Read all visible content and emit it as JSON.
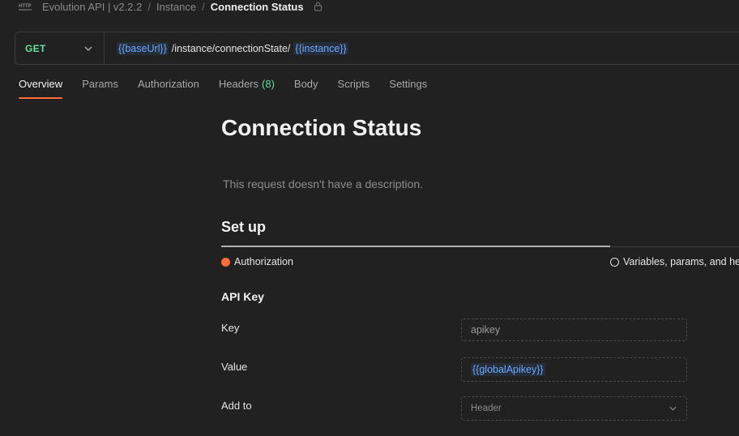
{
  "breadcrumb": {
    "icon": "http-icon",
    "collection": "Evolution API | v2.2.2",
    "folder": "Instance",
    "separator": "/",
    "current": "Connection Status",
    "lock_icon": "lock-icon"
  },
  "request": {
    "method": "GET",
    "url_parts": {
      "base": "{{baseUrl}}",
      "path": "/instance/connectionState/",
      "instance": "{{instance}}"
    }
  },
  "tabs": [
    {
      "label": "Overview",
      "active": true
    },
    {
      "label": "Params"
    },
    {
      "label": "Authorization"
    },
    {
      "label": "Headers",
      "count": "(8)"
    },
    {
      "label": "Body"
    },
    {
      "label": "Scripts"
    },
    {
      "label": "Settings"
    }
  ],
  "overview": {
    "title": "Connection Status",
    "description": "This request doesn't have a description.",
    "setup": {
      "heading": "Set up",
      "steps": [
        "Authorization",
        "Variables, params, and he"
      ]
    },
    "api_key": {
      "heading": "API Key",
      "key_label": "Key",
      "key_value": "apikey",
      "value_label": "Value",
      "value_value": "{{globalApikey}}",
      "add_to_label": "Add to",
      "add_to_value": "Header"
    }
  },
  "colors": {
    "background": "#212121",
    "accent": "#ff6c37",
    "method_get": "#6bdd9a",
    "variable": "#6aa9ff"
  }
}
